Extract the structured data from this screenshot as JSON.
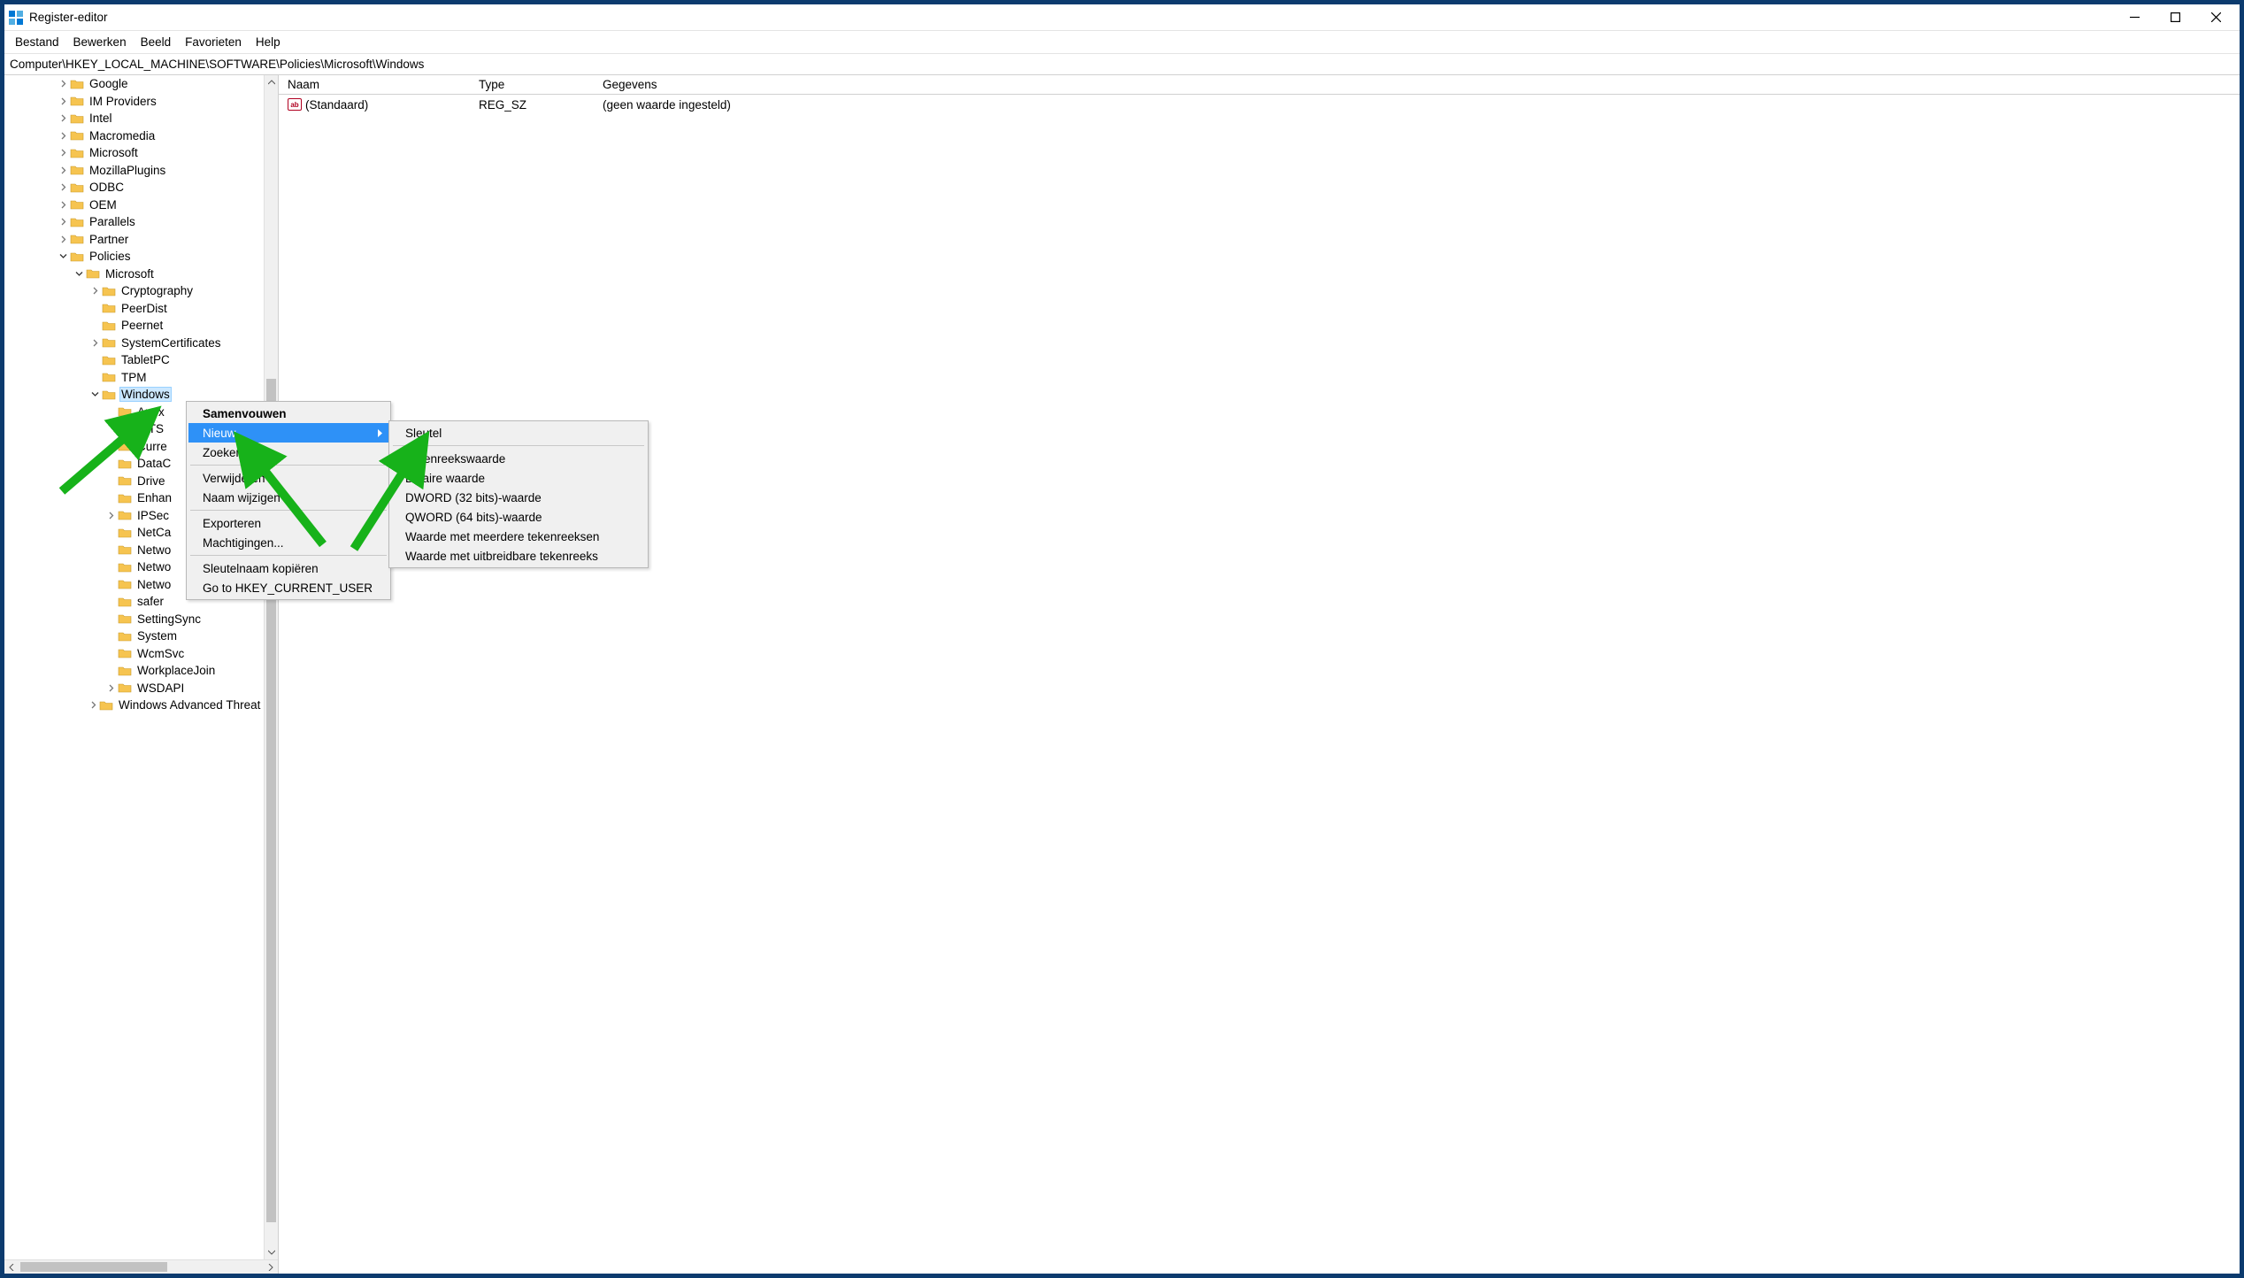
{
  "title": "Register-editor",
  "menubar": [
    "Bestand",
    "Bewerken",
    "Beeld",
    "Favorieten",
    "Help"
  ],
  "address": "Computer\\HKEY_LOCAL_MACHINE\\SOFTWARE\\Policies\\Microsoft\\Windows",
  "tree": [
    {
      "indent": 3,
      "exp": "closed",
      "label": "Google"
    },
    {
      "indent": 3,
      "exp": "closed",
      "label": "IM Providers"
    },
    {
      "indent": 3,
      "exp": "closed",
      "label": "Intel"
    },
    {
      "indent": 3,
      "exp": "closed",
      "label": "Macromedia"
    },
    {
      "indent": 3,
      "exp": "closed",
      "label": "Microsoft"
    },
    {
      "indent": 3,
      "exp": "closed",
      "label": "MozillaPlugins"
    },
    {
      "indent": 3,
      "exp": "closed",
      "label": "ODBC"
    },
    {
      "indent": 3,
      "exp": "closed",
      "label": "OEM"
    },
    {
      "indent": 3,
      "exp": "closed",
      "label": "Parallels"
    },
    {
      "indent": 3,
      "exp": "closed",
      "label": "Partner"
    },
    {
      "indent": 3,
      "exp": "open",
      "label": "Policies"
    },
    {
      "indent": 4,
      "exp": "open",
      "label": "Microsoft"
    },
    {
      "indent": 5,
      "exp": "closed",
      "label": "Cryptography"
    },
    {
      "indent": 5,
      "exp": "none",
      "label": "PeerDist"
    },
    {
      "indent": 5,
      "exp": "none",
      "label": "Peernet"
    },
    {
      "indent": 5,
      "exp": "closed",
      "label": "SystemCertificates"
    },
    {
      "indent": 5,
      "exp": "none",
      "label": "TabletPC"
    },
    {
      "indent": 5,
      "exp": "none",
      "label": "TPM"
    },
    {
      "indent": 5,
      "exp": "open",
      "label": "Windows",
      "selected": true
    },
    {
      "indent": 6,
      "exp": "none",
      "label": "Appx"
    },
    {
      "indent": 6,
      "exp": "none",
      "label": "BITS"
    },
    {
      "indent": 6,
      "exp": "none",
      "label": "CurrentVersion",
      "cut": true
    },
    {
      "indent": 6,
      "exp": "none",
      "label": "DataCollection",
      "cut": true
    },
    {
      "indent": 6,
      "exp": "none",
      "label": "DriverSearching",
      "cut": true
    },
    {
      "indent": 6,
      "exp": "none",
      "label": "EnhancedStorageDevices",
      "cut": true
    },
    {
      "indent": 6,
      "exp": "closed",
      "label": "IPSec"
    },
    {
      "indent": 6,
      "exp": "none",
      "label": "NetCache",
      "cut": true
    },
    {
      "indent": 6,
      "exp": "none",
      "label": "Network Connections",
      "cut": true
    },
    {
      "indent": 6,
      "exp": "none",
      "label": "NetworkConnectivityStatusIndicator",
      "cut": true
    },
    {
      "indent": 6,
      "exp": "none",
      "label": "NetworkProvider",
      "cut": true
    },
    {
      "indent": 6,
      "exp": "none",
      "label": "safer"
    },
    {
      "indent": 6,
      "exp": "none",
      "label": "SettingSync"
    },
    {
      "indent": 6,
      "exp": "none",
      "label": "System"
    },
    {
      "indent": 6,
      "exp": "none",
      "label": "WcmSvc"
    },
    {
      "indent": 6,
      "exp": "none",
      "label": "WorkplaceJoin"
    },
    {
      "indent": 6,
      "exp": "closed",
      "label": "WSDAPI"
    },
    {
      "indent": 5,
      "exp": "closed",
      "label": "Windows Advanced Threat Protection"
    }
  ],
  "list": {
    "headers": {
      "name": "Naam",
      "type": "Type",
      "data": "Gegevens"
    },
    "rows": [
      {
        "name": "(Standaard)",
        "type": "REG_SZ",
        "data": "(geen waarde ingesteld)"
      }
    ]
  },
  "context_primary": {
    "items": [
      {
        "label": "Samenvouwen",
        "bold": true
      },
      {
        "label": "Nieuw",
        "submenu": true,
        "highlight": true
      },
      {
        "label": "Zoeken..."
      },
      {
        "sep": true
      },
      {
        "label": "Verwijderen"
      },
      {
        "label": "Naam wijzigen"
      },
      {
        "sep": true
      },
      {
        "label": "Exporteren"
      },
      {
        "label": "Machtigingen..."
      },
      {
        "sep": true
      },
      {
        "label": "Sleutelnaam kopiëren"
      },
      {
        "label": "Go to HKEY_CURRENT_USER"
      }
    ]
  },
  "context_sub": {
    "items": [
      {
        "label": "Sleutel"
      },
      {
        "sep": true
      },
      {
        "label": "Tekenreekswaarde"
      },
      {
        "label": "Binaire waarde"
      },
      {
        "label": "DWORD (32 bits)-waarde"
      },
      {
        "label": "QWORD (64 bits)-waarde"
      },
      {
        "label": "Waarde met meerdere tekenreeksen"
      },
      {
        "label": "Waarde met uitbreidbare tekenreeks"
      }
    ]
  }
}
